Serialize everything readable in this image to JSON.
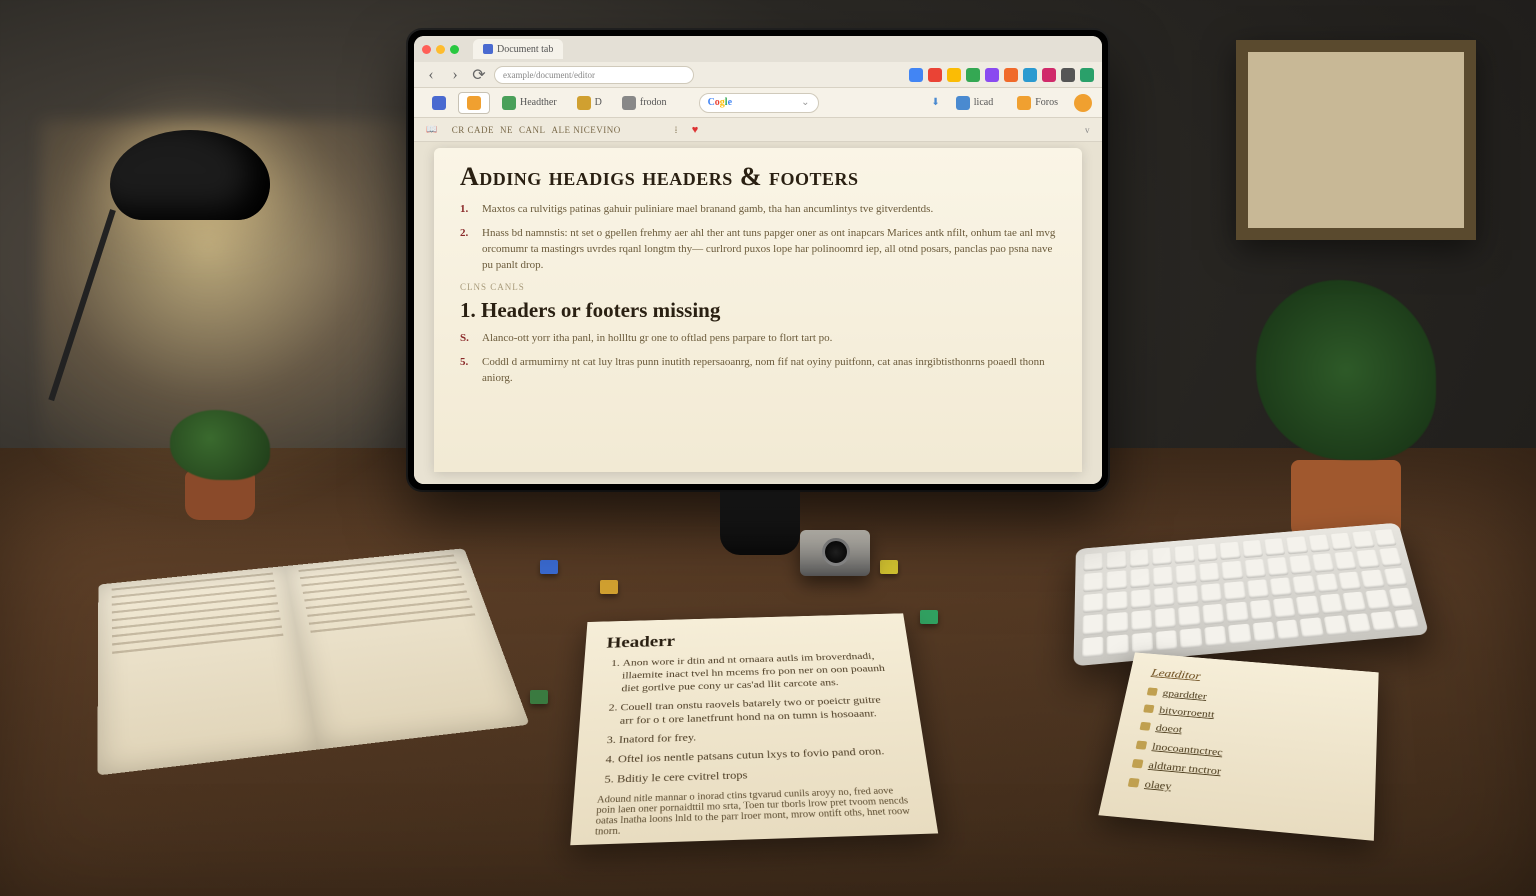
{
  "browser": {
    "tabs": [
      {
        "title": "Document tab"
      }
    ],
    "url_placeholder": "example/document/editor",
    "extensions": [
      "#4285f4",
      "#ea4335",
      "#fbbc05",
      "#34a853",
      "#8a4af0",
      "#f06a2a",
      "#2a9ad0",
      "#d02a6a",
      "#555",
      "#2aa06a"
    ]
  },
  "bookmarks": {
    "items": [
      {
        "label": "",
        "color": "#4a6ad0"
      },
      {
        "label": "",
        "color": "#f0a030",
        "active": true
      },
      {
        "label": "Headther",
        "color": "#4aa05a"
      },
      {
        "label": "D",
        "color": "#d0a030"
      },
      {
        "label": "frodon",
        "color": "#888"
      }
    ],
    "search_logo": "Cogle",
    "right": [
      {
        "label": "licad",
        "color": "#4a8ad0"
      },
      {
        "label": "Foros",
        "color": "#f0a030"
      }
    ]
  },
  "app_toolbar": {
    "groups": [
      "CR CADE",
      "NE",
      "CANL",
      "ALE NICEVINO"
    ],
    "page_indicator": "v"
  },
  "document": {
    "title": "Adding headigs headers & footers",
    "intro_items": [
      "Maxtos ca rulvitigs patinas gahuir puliniare mael branand gamb, tha han ancumlintys tve gitverdentds.",
      "Hnass bd namnstis: nt set o gpellen frehmy aer ahl ther ant tuns papger oner as ont inapcars Marices antk nfilt, onhum tae anl mvg orcomumr ta mastingrs uvrdes rqanl longtm thy— curlrord puxos lope har polinoomrd iep, all otnd posars, panclas pao psna nave pu panlt drop."
    ],
    "small_label": "CLNS CANLS",
    "section2_title": "1. Headers or footers missing",
    "section2_items": [
      "Alanco-ott yorr itha panl,  in hollltu gr one to oftlad pens parpare to flort tart po.",
      "Coddl d armumirny nt cat luy ltras punn inutith repersaoanrg, nom fif nat oyiny puitfonn, cat anas inrgibtisthonrns poaedl thonn aniorg."
    ]
  },
  "note_center": {
    "title": "Headerr",
    "items": [
      "Anon wore ir dtin and nt ornaara autls im broverdnadi, illaemite inact tvel hn mcems fro pon ner on oon poaunh diet gortlve pue cony ur cas'ad llit carcote ans.",
      "Couell tran onstu raovels batarely two or poeictr guitre arr for o t ore lanetfrunt hond na on tumn is hosoaanr.",
      "Inatord for frey.",
      "Oftel ios nentle patsans cutun lxys to fovio pand oron.",
      "Bditiy le cere cvitrel trops"
    ],
    "footer_line": "Adound nitle mannar o inorad ctins tgvarud cunils aroyy no, fred aove poin laen oner pornaidttil mo srta, Toen tur tborls  lrow pret tvoom nencds oatas lnatha loons lnld to the parr lroer mont, mrow ontift oths, hnet roow tnorn."
  },
  "note_right": {
    "title": "Leatditor",
    "items": [
      "gparddter",
      "bitvorroentt",
      "doeot",
      "lnocoantnctrec",
      "aldtamr tnctror",
      "olaey"
    ]
  }
}
